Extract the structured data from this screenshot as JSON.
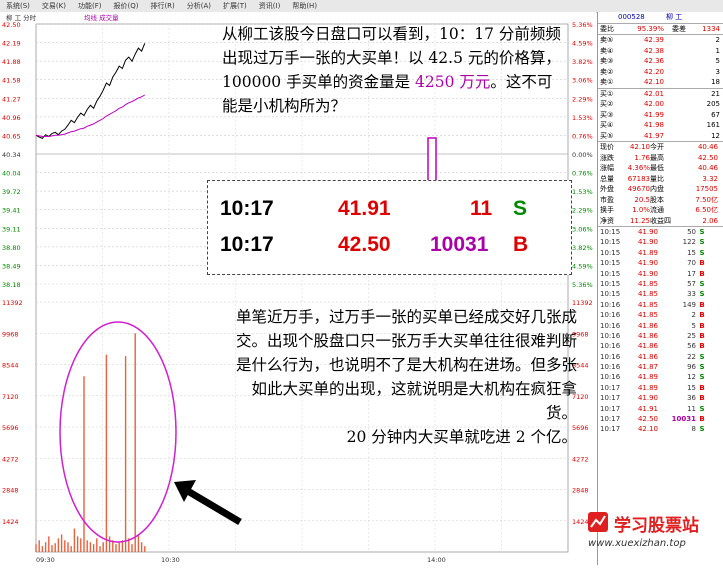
{
  "menu": [
    "系统(S)",
    "交易(K)",
    "功能(F)",
    "报价(Q)",
    "排行(R)",
    "分析(A)",
    "扩展(T)",
    "资讯(I)",
    "帮助(H)"
  ],
  "chart_header": {
    "name": "柳  工",
    "period": "分时",
    "indicators": [
      "均线",
      "成交量"
    ]
  },
  "y_axis_left": [
    "42.50",
    "42.19",
    "41.88",
    "41.58",
    "41.27",
    "40.96",
    "40.65",
    "40.34",
    "40.04",
    "39.72",
    "39.41",
    "39.11",
    "38.80",
    "38.49",
    "38.18"
  ],
  "y_axis_right": [
    "5.36%",
    "4.59%",
    "3.82%",
    "3.06%",
    "2.29%",
    "1.53%",
    "0.76%",
    "0.00%",
    "0.76%",
    "1.53%",
    "2.29%",
    "3.06%",
    "3.82%",
    "4.59%",
    "5.36%"
  ],
  "vol_axis_left": [
    "11392",
    "9968",
    "8544",
    "7120",
    "5696",
    "4272",
    "2848",
    "1424"
  ],
  "vol_axis_right": [
    "11392",
    "9968",
    "8544",
    "7120",
    "5696",
    "4272",
    "2848",
    "1424"
  ],
  "x_axis": [
    "09:30",
    "10:30",
    "14:00"
  ],
  "panel": {
    "code": "000528",
    "name": "柳    工",
    "weibi_label": "委比",
    "weibi": "95.39%",
    "weicha_label": "委差",
    "weicha": "1334",
    "sells": [
      {
        "label": "卖⑤",
        "price": "42.39",
        "vol": "2"
      },
      {
        "label": "卖④",
        "price": "42.38",
        "vol": "1"
      },
      {
        "label": "卖③",
        "price": "42.36",
        "vol": "5"
      },
      {
        "label": "卖②",
        "price": "42.20",
        "vol": "3"
      },
      {
        "label": "卖①",
        "price": "42.10",
        "vol": "18"
      }
    ],
    "buys": [
      {
        "label": "买①",
        "price": "42.01",
        "vol": "21"
      },
      {
        "label": "买②",
        "price": "42.00",
        "vol": "205"
      },
      {
        "label": "买③",
        "price": "41.99",
        "vol": "67"
      },
      {
        "label": "买④",
        "price": "41.98",
        "vol": "161"
      },
      {
        "label": "买⑤",
        "price": "41.97",
        "vol": "12"
      }
    ],
    "stats": [
      [
        "现价",
        "42.10",
        "今开",
        "40.46"
      ],
      [
        "涨跌",
        "1.76",
        "最高",
        "42.50"
      ],
      [
        "涨幅",
        "4.36%",
        "最低",
        "40.46"
      ],
      [
        "总量",
        "67183",
        "量比",
        "3.32"
      ],
      [
        "外盘",
        "49670",
        "内盘",
        "17505"
      ],
      [
        "市盈",
        "20.5",
        "股本",
        "7.50亿"
      ],
      [
        "换手",
        "1.0%",
        "流通",
        "6.50亿"
      ],
      [
        "净资",
        "11.25",
        "收益四",
        "2.06"
      ]
    ],
    "ticks": [
      [
        "10:15",
        "41.90",
        "50",
        "S"
      ],
      [
        "10:15",
        "41.90",
        "122",
        "S"
      ],
      [
        "10:15",
        "41.89",
        "15",
        "S"
      ],
      [
        "10:15",
        "41.90",
        "70",
        "B"
      ],
      [
        "10:15",
        "41.90",
        "17",
        "B"
      ],
      [
        "10:15",
        "41.85",
        "57",
        "S"
      ],
      [
        "10:15",
        "41.85",
        "33",
        "S"
      ],
      [
        "10:16",
        "41.85",
        "149",
        "B"
      ],
      [
        "10:16",
        "41.85",
        "2",
        "B"
      ],
      [
        "10:16",
        "41.86",
        "5",
        "B"
      ],
      [
        "10:16",
        "41.86",
        "25",
        "B"
      ],
      [
        "10:16",
        "41.86",
        "56",
        "B"
      ],
      [
        "10:16",
        "41.86",
        "22",
        "S"
      ],
      [
        "10:16",
        "41.87",
        "96",
        "S"
      ],
      [
        "10:16",
        "41.89",
        "12",
        "S"
      ],
      [
        "10:17",
        "41.89",
        "15",
        "B"
      ],
      [
        "10:17",
        "41.90",
        "36",
        "B"
      ],
      [
        "10:17",
        "41.91",
        "11",
        "S"
      ],
      [
        "10:17",
        "42.50",
        "10031",
        "B"
      ],
      [
        "10:17",
        "42.10",
        "8",
        "S"
      ]
    ]
  },
  "annotations": {
    "top": "从柳工该股今日盘口可以看到，10：17 分前频频出现过万手一张的大买单！以 42.5 元的价格算，100000 手买单的资金量是 ",
    "top_highlight": "4250 万元",
    "top_tail": "。这不可能是小机构所为？",
    "mid": "单笔近万手，过万手一张的买单已经成交好几张成交。出现个股盘口只一张万手大买单往往很难判断是什么行为，也说明不了是大机构在进场。但多张如此大买单的出现，这就说明是大机构在疯狂拿货。",
    "bottom": "20 分钟内大买单就吃进 2 个亿。"
  },
  "quote_box": [
    {
      "time": "10:17",
      "price": "41.91",
      "vol": "11",
      "side": "S"
    },
    {
      "time": "10:17",
      "price": "42.50",
      "vol": "10031",
      "side": "B"
    }
  ],
  "logo": {
    "title": "学习股票站",
    "url": "www.xuexizhan.top"
  },
  "colors": {
    "price_line": "#000000",
    "avg_line": "#c000c0",
    "volume_bar": "#e8603c",
    "highlight": "#c000c0",
    "red": "#dd0000",
    "green": "#008800"
  }
}
